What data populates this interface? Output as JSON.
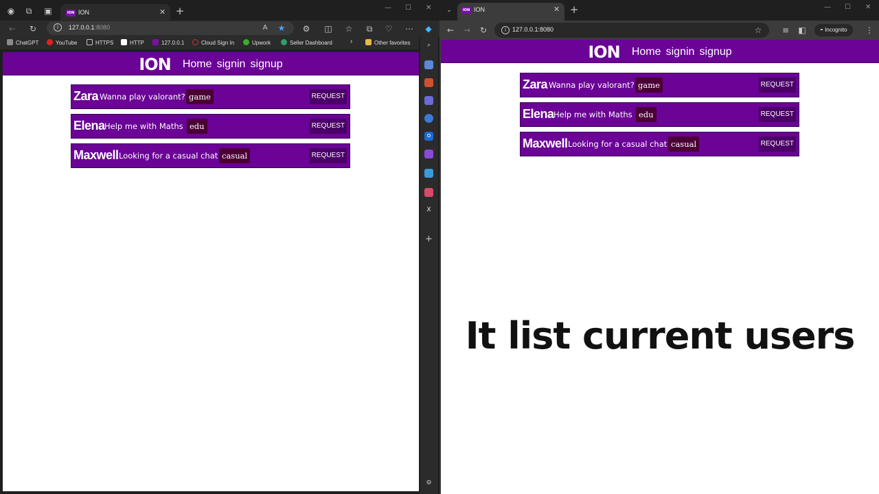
{
  "left_browser": {
    "tab_title": "ION",
    "url_host": "127.0.0.1",
    "url_port": ":8080",
    "bookmarks": [
      {
        "label": "ChatGPT",
        "color": "#8a8a8a"
      },
      {
        "label": "YouTube",
        "color": "#e02020"
      },
      {
        "label": "HTTPS",
        "color": "#c8c8c8"
      },
      {
        "label": "HTTP",
        "color": "#ffffff"
      },
      {
        "label": "127.0.0.1",
        "color": "#7a0fa8"
      },
      {
        "label": "Cloud Sign In",
        "color": "#d03030"
      },
      {
        "label": "Upwork",
        "color": "#3cae2c"
      },
      {
        "label": "Seller Dashboard",
        "color": "#2fa06a"
      }
    ],
    "other_favorites": "Other favorites"
  },
  "right_browser": {
    "tab_title": "ION",
    "url": "127.0.0.1:8080",
    "incognito_label": "Incognito"
  },
  "site": {
    "logo": "ION",
    "nav": [
      "Home",
      "signin",
      "signup"
    ],
    "users": [
      {
        "name": "Zara",
        "message": "Wanna play valorant?",
        "tag": "game",
        "action": "REQUEST"
      },
      {
        "name": "Elena",
        "message": "Help me with Maths",
        "tag": "edu",
        "action": "REQUEST"
      },
      {
        "name": "Maxwell",
        "message": "Looking for a casual chat",
        "tag": "casual",
        "action": "REQUEST"
      }
    ]
  },
  "caption": "It list current users",
  "colors": {
    "header": "#6a0396",
    "tag_bg": "#4a0035",
    "browser_dark": "#1f1f1f"
  }
}
